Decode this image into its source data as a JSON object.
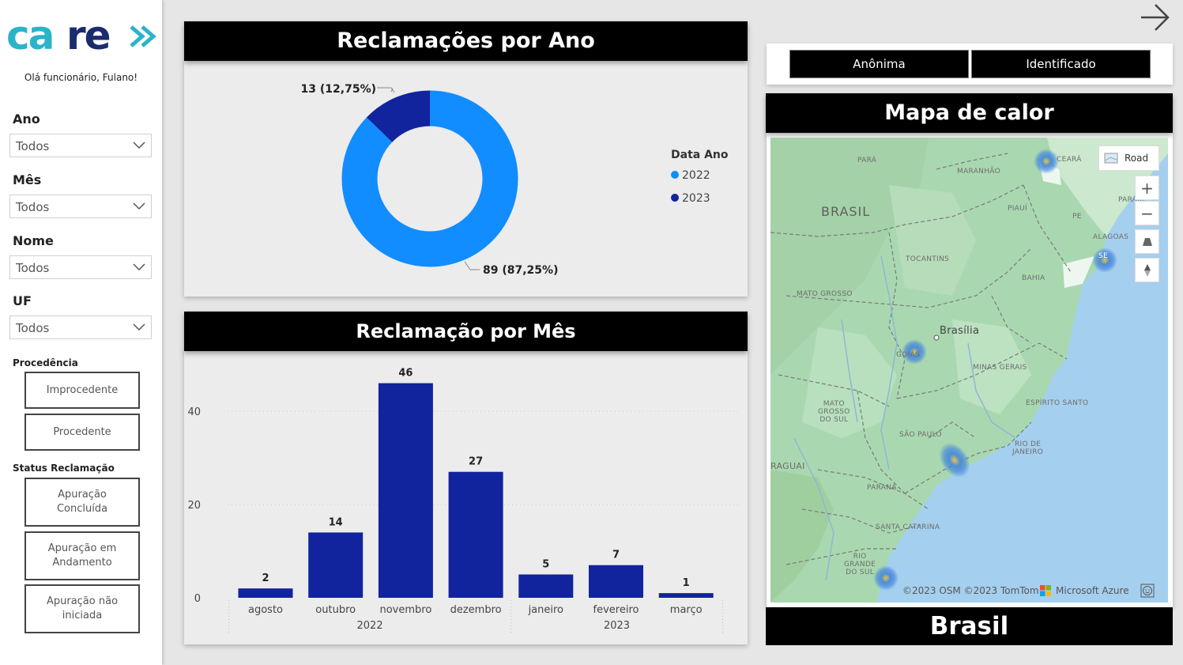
{
  "sidebar": {
    "logo_text": "care",
    "greeting": "Olá funcionário, Fulano!",
    "filters": [
      {
        "label": "Ano",
        "value": "Todos"
      },
      {
        "label": "Mês",
        "value": "Todos"
      },
      {
        "label": "Nome",
        "value": "Todos"
      },
      {
        "label": "UF",
        "value": "Todos"
      }
    ],
    "procedencia": {
      "label": "Procedência",
      "buttons": [
        "Improcedente",
        "Procedente"
      ]
    },
    "status": {
      "label": "Status Reclamação",
      "buttons": [
        "Apuração Concluída",
        "Apuração em Andamento",
        "Apuração não iniciada"
      ]
    }
  },
  "colors": {
    "brand_teal": "#2bb3c9",
    "brand_navy": "#1b2b6e",
    "donut_2022": "#118dff",
    "donut_2023": "#12239e",
    "bar": "#12239e"
  },
  "donut": {
    "title": "Reclamações por Ano",
    "legend_title": "Data Ano",
    "slices": [
      {
        "name": "2022",
        "value": 89,
        "label": "89 (87,25%)"
      },
      {
        "name": "2023",
        "value": 13,
        "label": "13 (12,75%)"
      }
    ]
  },
  "bar_chart": {
    "title": "Reclamação por Mês"
  },
  "chart_data": {
    "type": "bar",
    "categories": [
      "agosto",
      "outubro",
      "novembro",
      "dezembro",
      "janeiro",
      "fevereiro",
      "março"
    ],
    "groups": [
      {
        "label": "2022",
        "categories": [
          "agosto",
          "outubro",
          "novembro",
          "dezembro"
        ]
      },
      {
        "label": "2023",
        "categories": [
          "janeiro",
          "fevereiro",
          "março"
        ]
      }
    ],
    "values": [
      2,
      14,
      46,
      27,
      5,
      7,
      1
    ],
    "y_ticks": [
      0,
      20,
      40
    ],
    "ylim": [
      0,
      50
    ],
    "grid": true
  },
  "toggles": [
    "Anônima",
    "Identificado"
  ],
  "map": {
    "title": "Mapa de calor",
    "style_button": "Road",
    "labels": {
      "country": "BRASIL",
      "capital": "Brasília",
      "para": "PARÁ",
      "maranhao": "MARANHÃO",
      "ceara": "CEARÁ",
      "piaui": "PIAUÍ",
      "paraiba": "PARAÍB",
      "pe": "PE",
      "alagoas": "ALAGOAS",
      "se": "SE",
      "tocantins": "TOCANTINS",
      "bahia": "BAHIA",
      "mato_grosso": "MATO GROSSO",
      "goias": "GOIÁS",
      "minas": "MINAS GERAIS",
      "espirito": "ESPÍRITO SANTO",
      "mato_grosso_sul": "MATO\nGROSSO\nDO SUL",
      "sao_paulo": "SÃO PAULO",
      "rio": "RIO DE\nJANEIRO",
      "paraguai": "RAGUAI",
      "parana": "PARANÁ",
      "santa_catarina": "SANTA CATARINA",
      "rio_grande": "RIO\nGRANDE\nDO SUL"
    },
    "attribution": "©2023 OSM  ©2023 TomTom",
    "provider": "Microsoft Azure"
  },
  "footer_title": "Brasil"
}
